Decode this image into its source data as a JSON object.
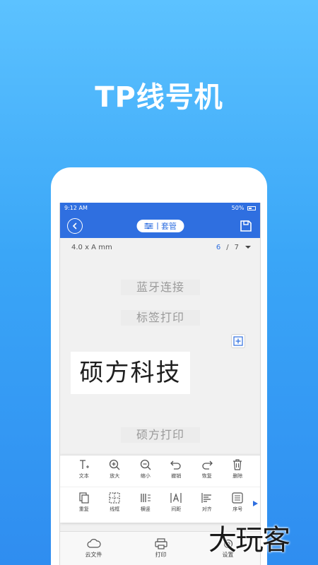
{
  "promo": {
    "title": "TP线号机"
  },
  "status_bar": {
    "time": "9:12 AM",
    "battery": "50%"
  },
  "app_bar": {
    "suite_label": "套管"
  },
  "info": {
    "size": "4.0 x A mm",
    "current_page": "6",
    "separator": "/",
    "total_pages": "7"
  },
  "canvas": {
    "labels": [
      "蓝牙连接",
      "标签打印",
      "硕方打印"
    ],
    "main_text": "硕方科技"
  },
  "toolbar": {
    "row1": [
      "文本",
      "放大",
      "缩小",
      "撤销",
      "恢复",
      "删除"
    ],
    "row2": [
      "重复",
      "线框",
      "横竖",
      "间距",
      "对齐",
      "序号"
    ]
  },
  "bottom_nav": [
    "云文件",
    "打印",
    "设置"
  ],
  "watermark": "大玩客",
  "colors": {
    "accent": "#2f6fe0",
    "background_top": "#5cc2ff",
    "background_bottom": "#2f8df0"
  }
}
